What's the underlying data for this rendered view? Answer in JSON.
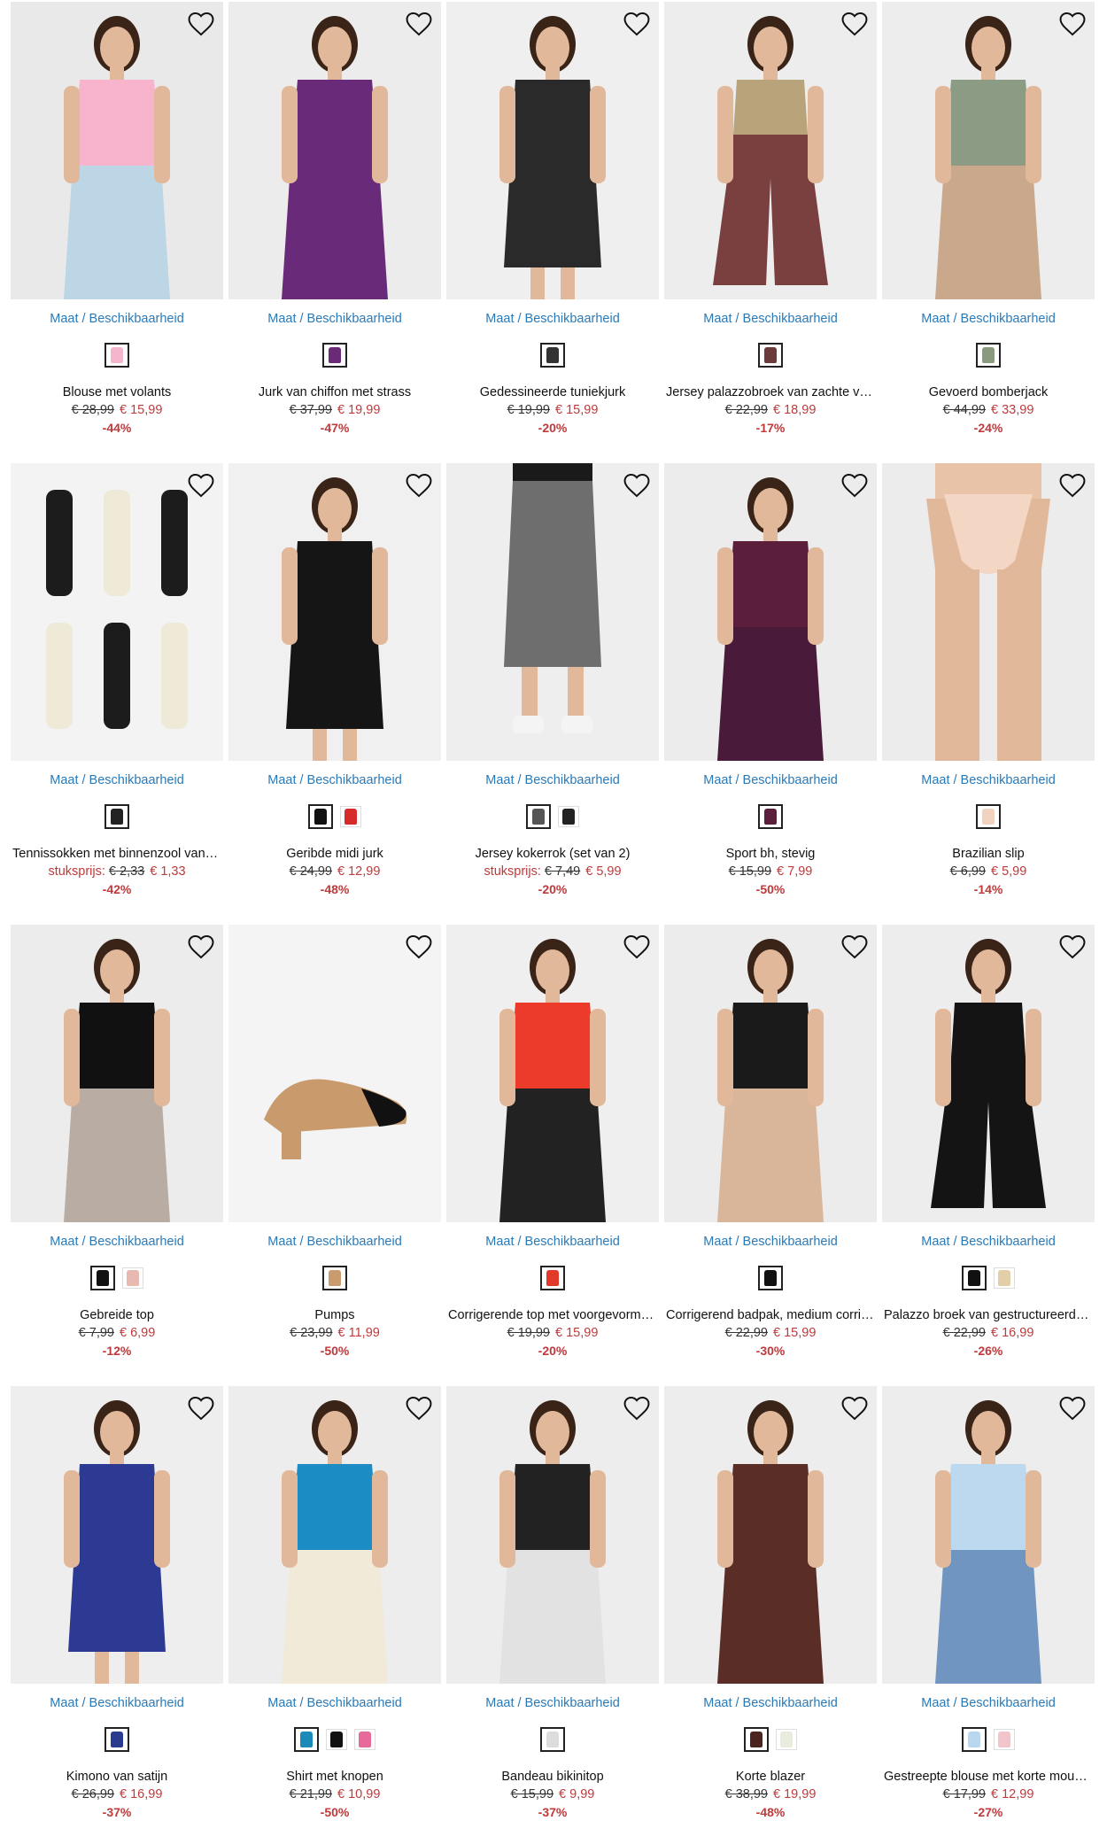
{
  "labels": {
    "size_availability": "Maat / Beschikbaarheid",
    "per_piece": "stuksprijs:"
  },
  "products": [
    {
      "name": "Blouse met volants",
      "old_price": "€ 28,99",
      "new_price": "€ 15,99",
      "discount": "-44%",
      "colors": [
        "#f5b5cc"
      ],
      "bg": "#e9e9ea",
      "top": "#f7b4cc",
      "bottom": "#bcd6e6",
      "kind": "person"
    },
    {
      "name": "Jurk van chiffon met strass",
      "old_price": "€ 37,99",
      "new_price": "€ 19,99",
      "discount": "-47%",
      "colors": [
        "#6b2a78"
      ],
      "bg": "#ececec",
      "top": "#6a2a7a",
      "bottom": "#6a2a7a",
      "kind": "person"
    },
    {
      "name": "Gedessineerde tuniekjurk",
      "old_price": "€ 19,99",
      "new_price": "€ 15,99",
      "discount": "-20%",
      "colors": [
        "#333333"
      ],
      "bg": "#efefef",
      "top": "#2a2a2a",
      "bottom": "#2a2a2a",
      "kind": "dress"
    },
    {
      "name": "Jersey palazzobroek van zachte viscose",
      "old_price": "€ 22,99",
      "new_price": "€ 18,99",
      "discount": "-17%",
      "colors": [
        "#6b3a3a"
      ],
      "bg": "#ededed",
      "top": "#b8a37a",
      "bottom": "#7a4040",
      "kind": "pants"
    },
    {
      "name": "Gevoerd bomberjack",
      "old_price": "€ 44,99",
      "new_price": "€ 33,99",
      "discount": "-24%",
      "colors": [
        "#8a9a7e"
      ],
      "bg": "#ededed",
      "top": "#8c9c84",
      "bottom": "#c9a88b",
      "kind": "person"
    },
    {
      "name": "Tennissokken met binnenzool van badstof",
      "pre": "stuksprijs:",
      "old_price": "€ 2,33",
      "new_price": "€ 1,33",
      "discount": "-42%",
      "colors": [
        "#222222"
      ],
      "bg": "#f3f3f3",
      "top": "#1c1c1c",
      "bottom": "#efe9d8",
      "kind": "socks"
    },
    {
      "name": "Geribde midi jurk",
      "old_price": "€ 24,99",
      "new_price": "€ 12,99",
      "discount": "-48%",
      "colors": [
        "#111111",
        "#d62b2b"
      ],
      "bg": "#f0f0f0",
      "top": "#151515",
      "bottom": "#151515",
      "kind": "dress"
    },
    {
      "name": "Jersey kokerrok (set van 2)",
      "pre": "stuksprijs:",
      "old_price": "€ 7,49",
      "new_price": "€ 5,99",
      "discount": "-20%",
      "colors": [
        "#555555",
        "#222222"
      ],
      "bg": "#eeeeee",
      "top": "#f4f4f4",
      "bottom": "#6e6e6e",
      "kind": "skirt"
    },
    {
      "name": "Sport bh, stevig",
      "old_price": "€ 15,99",
      "new_price": "€ 7,99",
      "discount": "-50%",
      "colors": [
        "#5a1f3a"
      ],
      "bg": "#ececec",
      "top": "#5b1f3b",
      "bottom": "#4a1a3a",
      "kind": "person"
    },
    {
      "name": "Brazilian slip",
      "old_price": "€ 6,99",
      "new_price": "€ 5,99",
      "discount": "-14%",
      "colors": [
        "#f2d3c0"
      ],
      "bg": "#ececec",
      "top": "#e9c3a8",
      "bottom": "#f3d6c4",
      "kind": "legs"
    },
    {
      "name": "Gebreide top",
      "old_price": "€ 7,99",
      "new_price": "€ 6,99",
      "discount": "-12%",
      "colors": [
        "#111111",
        "#e8b9b0"
      ],
      "bg": "#ececec",
      "top": "#111111",
      "bottom": "#b9aca2",
      "kind": "person"
    },
    {
      "name": "Pumps",
      "old_price": "€ 23,99",
      "new_price": "€ 11,99",
      "discount": "-50%",
      "colors": [
        "#c99b6d"
      ],
      "bg": "#f4f4f4",
      "top": "#c89a6c",
      "bottom": "#111111",
      "kind": "shoe"
    },
    {
      "name": "Corrigerende top met voorgevormde cups",
      "old_price": "€ 19,99",
      "new_price": "€ 15,99",
      "discount": "-20%",
      "colors": [
        "#e23a2a"
      ],
      "bg": "#efefef",
      "top": "#ec3b2a",
      "bottom": "#222222",
      "kind": "person"
    },
    {
      "name": "Corrigerend badpak, medium corrigerend",
      "old_price": "€ 22,99",
      "new_price": "€ 15,99",
      "discount": "-30%",
      "colors": [
        "#111111"
      ],
      "bg": "#ececec",
      "top": "#1a1a1a",
      "bottom": "#d9b59a",
      "kind": "person"
    },
    {
      "name": "Palazzo broek van gestructureerde stof",
      "old_price": "€ 22,99",
      "new_price": "€ 16,99",
      "discount": "-26%",
      "colors": [
        "#111111",
        "#e2cfa8"
      ],
      "bg": "#ededed",
      "top": "#141414",
      "bottom": "#141414",
      "kind": "pants"
    },
    {
      "name": "Kimono van satijn",
      "old_price": "€ 26,99",
      "new_price": "€ 16,99",
      "discount": "-37%",
      "colors": [
        "#2a3b8f"
      ],
      "bg": "#eeeeee",
      "top": "#2d3a94",
      "bottom": "#2d3a94",
      "kind": "dress"
    },
    {
      "name": "Shirt met knopen",
      "old_price": "€ 21,99",
      "new_price": "€ 10,99",
      "discount": "-50%",
      "colors": [
        "#1a8ab8",
        "#111111",
        "#e86a9a"
      ],
      "bg": "#ededed",
      "top": "#1b8dc4",
      "bottom": "#f1ead8",
      "kind": "person"
    },
    {
      "name": "Bandeau bikinitop",
      "old_price": "€ 15,99",
      "new_price": "€ 9,99",
      "discount": "-37%",
      "colors": [
        "#dcdcdc"
      ],
      "bg": "#ededed",
      "top": "#222222",
      "bottom": "#e2e2e2",
      "kind": "person"
    },
    {
      "name": "Korte blazer",
      "old_price": "€ 38,99",
      "new_price": "€ 19,99",
      "discount": "-48%",
      "colors": [
        "#4a2520",
        "#e8ecdc"
      ],
      "bg": "#ededed",
      "top": "#5a2e26",
      "bottom": "#5a2e26",
      "kind": "person"
    },
    {
      "name": "Gestreepte blouse met korte mouwen",
      "old_price": "€ 17,99",
      "new_price": "€ 12,99",
      "discount": "-27%",
      "colors": [
        "#b9d7ee",
        "#f2c4cc"
      ],
      "bg": "#ededed",
      "top": "#bcd9ef",
      "bottom": "#6f95c0",
      "kind": "person"
    }
  ]
}
